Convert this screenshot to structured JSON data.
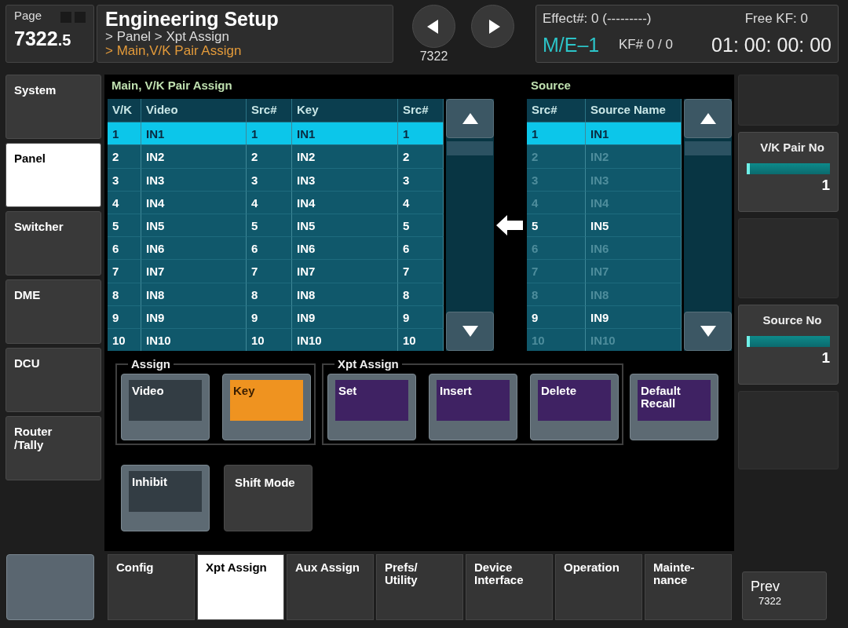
{
  "page": {
    "label": "Page",
    "number": "7322",
    "sub": ".5"
  },
  "header": {
    "title": "Engineering Setup",
    "path": "> Panel > Xpt Assign",
    "current": "> Main,V/K Pair Assign"
  },
  "nav": {
    "page_label": "7322"
  },
  "status": {
    "effect": "Effect#: 0 (---------)",
    "free_kf": "Free KF: 0",
    "me": "M/E–1",
    "kf": "KF# 0 / 0",
    "timecode": "01: 00: 00: 00"
  },
  "sidebar": {
    "items": [
      {
        "label": "System",
        "selected": false
      },
      {
        "label": "Panel",
        "selected": true
      },
      {
        "label": "Switcher",
        "selected": false
      },
      {
        "label": "DME",
        "selected": false
      },
      {
        "label": "DCU",
        "selected": false
      },
      {
        "label": "Router\n/Tally",
        "selected": false
      }
    ]
  },
  "pair_table": {
    "title": "Main, V/K Pair Assign",
    "columns": [
      "V/K",
      "Video",
      "Src#",
      "Key",
      "Src#"
    ],
    "rows": [
      {
        "cells": [
          "1",
          "IN1",
          "1",
          "IN1",
          "1"
        ],
        "selected": true
      },
      {
        "cells": [
          "2",
          "IN2",
          "2",
          "IN2",
          "2"
        ],
        "selected": false
      },
      {
        "cells": [
          "3",
          "IN3",
          "3",
          "IN3",
          "3"
        ],
        "selected": false
      },
      {
        "cells": [
          "4",
          "IN4",
          "4",
          "IN4",
          "4"
        ],
        "selected": false
      },
      {
        "cells": [
          "5",
          "IN5",
          "5",
          "IN5",
          "5"
        ],
        "selected": false
      },
      {
        "cells": [
          "6",
          "IN6",
          "6",
          "IN6",
          "6"
        ],
        "selected": false
      },
      {
        "cells": [
          "7",
          "IN7",
          "7",
          "IN7",
          "7"
        ],
        "selected": false
      },
      {
        "cells": [
          "8",
          "IN8",
          "8",
          "IN8",
          "8"
        ],
        "selected": false
      },
      {
        "cells": [
          "9",
          "IN9",
          "9",
          "IN9",
          "9"
        ],
        "selected": false
      },
      {
        "cells": [
          "10",
          "IN10",
          "10",
          "IN10",
          "10"
        ],
        "selected": false
      }
    ]
  },
  "source_table": {
    "title": "Source",
    "columns": [
      "Src#",
      "Source Name"
    ],
    "rows": [
      {
        "cells": [
          "1",
          "IN1"
        ],
        "selected": true,
        "disabled": false
      },
      {
        "cells": [
          "2",
          "IN2"
        ],
        "selected": false,
        "disabled": true
      },
      {
        "cells": [
          "3",
          "IN3"
        ],
        "selected": false,
        "disabled": true
      },
      {
        "cells": [
          "4",
          "IN4"
        ],
        "selected": false,
        "disabled": true
      },
      {
        "cells": [
          "5",
          "IN5"
        ],
        "selected": false,
        "disabled": false
      },
      {
        "cells": [
          "6",
          "IN6"
        ],
        "selected": false,
        "disabled": true
      },
      {
        "cells": [
          "7",
          "IN7"
        ],
        "selected": false,
        "disabled": true
      },
      {
        "cells": [
          "8",
          "IN8"
        ],
        "selected": false,
        "disabled": true
      },
      {
        "cells": [
          "9",
          "IN9"
        ],
        "selected": false,
        "disabled": false
      },
      {
        "cells": [
          "10",
          "IN10"
        ],
        "selected": false,
        "disabled": true
      }
    ]
  },
  "groups": [
    {
      "label": "Assign",
      "buttons": [
        {
          "label": "Video",
          "kind": "toggle",
          "on": false
        },
        {
          "label": "Key",
          "kind": "toggle",
          "on": true
        }
      ]
    },
    {
      "label": "Xpt Assign",
      "buttons": [
        {
          "label": "Set",
          "kind": "action"
        },
        {
          "label": "Insert",
          "kind": "action"
        },
        {
          "label": "Delete",
          "kind": "action"
        }
      ]
    }
  ],
  "extra_buttons": [
    {
      "label": "Default\nRecall",
      "kind": "action"
    }
  ],
  "lower_buttons": [
    {
      "label": "Inhibit",
      "kind": "toggle",
      "on": false
    },
    {
      "label": "Shift Mode",
      "kind": "plain"
    }
  ],
  "knobs": [
    {
      "label": "V/K Pair No",
      "level": 0,
      "value": "1"
    },
    {
      "label": "Source No",
      "level": 0,
      "value": "1"
    }
  ],
  "tabs": [
    {
      "label": "Config",
      "selected": false
    },
    {
      "label": "Xpt Assign",
      "selected": true
    },
    {
      "label": "Aux Assign",
      "selected": false
    },
    {
      "label": "Prefs/\nUtility",
      "selected": false
    },
    {
      "label": "Device\nInterface",
      "selected": false
    },
    {
      "label": "Operation",
      "selected": false
    },
    {
      "label": "Mainte-\nnance",
      "selected": false
    }
  ],
  "prev": {
    "label": "Prev",
    "page": "7322"
  }
}
